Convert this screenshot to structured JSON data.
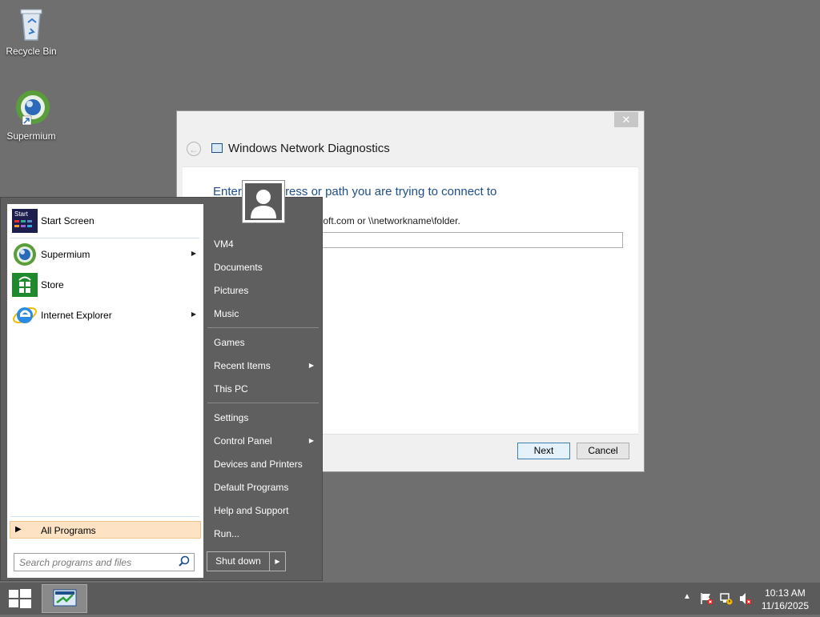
{
  "desktop": {
    "icons": [
      {
        "label": "Recycle Bin"
      },
      {
        "label": "Supermium"
      }
    ]
  },
  "dialog": {
    "title": "Windows Network Diagnostics",
    "close_glyph": "✕",
    "back_glyph": "←",
    "heading": "Enter the address or path you are trying to connect to",
    "description": "For example, www.microsoft.com or \\\\networkname\\folder.",
    "address_value": "",
    "next_label": "Next",
    "cancel_label": "Cancel"
  },
  "start_menu": {
    "pinned": [
      {
        "label": "Start Screen",
        "icon": "start-screen-icon",
        "has_submenu": false
      },
      {
        "label": "Supermium",
        "icon": "supermium-icon",
        "has_submenu": true
      },
      {
        "label": "Store",
        "icon": "store-icon",
        "has_submenu": false
      },
      {
        "label": "Internet Explorer",
        "icon": "internet-explorer-icon",
        "has_submenu": true
      }
    ],
    "start_tile_text": "Start",
    "all_programs_label": "All Programs",
    "search_placeholder": "Search programs and files",
    "right_items": [
      {
        "label": "VM4"
      },
      {
        "label": "Documents"
      },
      {
        "label": "Pictures"
      },
      {
        "label": "Music"
      },
      {
        "label": "Games"
      },
      {
        "label": "Recent Items"
      },
      {
        "label": "This PC"
      },
      {
        "label": "Settings"
      },
      {
        "label": "Control Panel"
      },
      {
        "label": "Devices and Printers"
      },
      {
        "label": "Default Programs"
      },
      {
        "label": "Help and Support"
      },
      {
        "label": "Run..."
      }
    ],
    "submenu_arrow": "▶",
    "shutdown_label": "Shut down"
  },
  "taskbar": {
    "time": "10:13 AM",
    "date": "11/16/2025",
    "tray_chevron": "▲"
  },
  "colors": {
    "desktop_bg": "#6f6f6f",
    "accent_blue": "#1f4e8c",
    "start_menu_bg": "#5f5f5f"
  }
}
